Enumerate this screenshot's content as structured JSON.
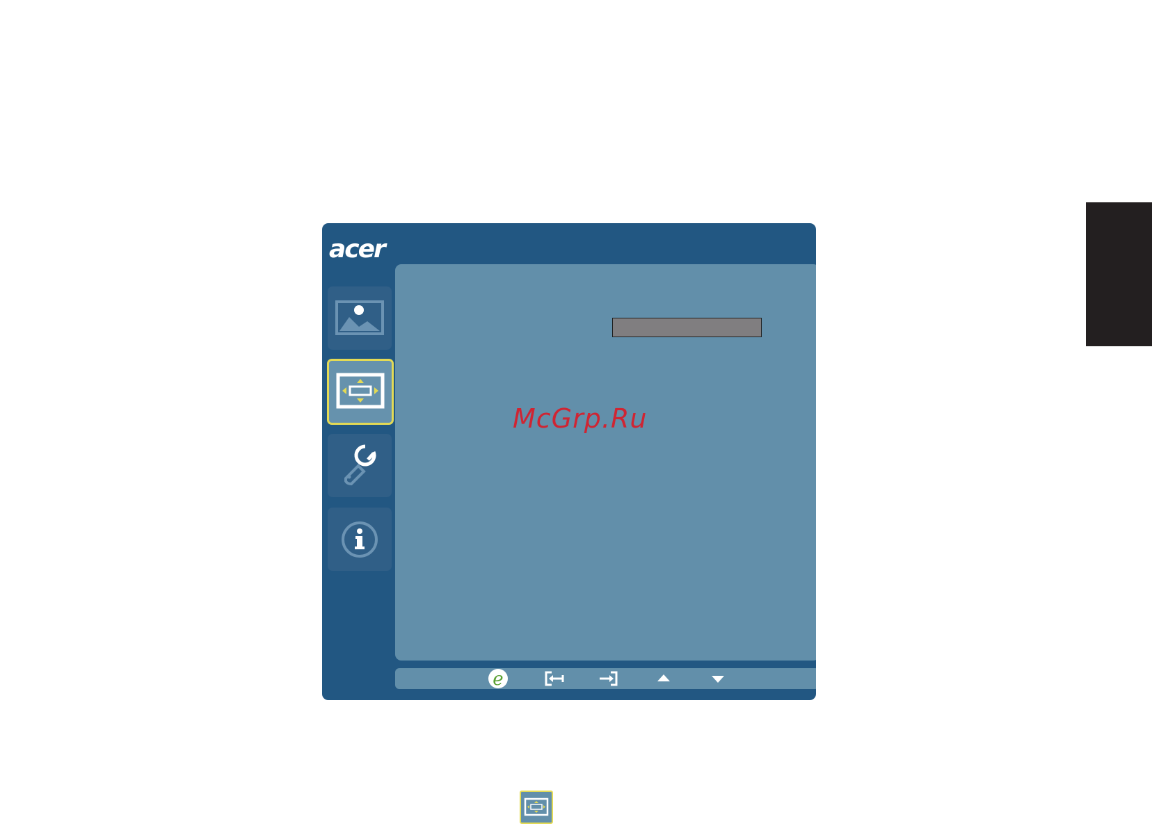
{
  "osd": {
    "brand": "acer",
    "tabs": [
      {
        "id": "picture",
        "icon": "picture-icon",
        "active": false
      },
      {
        "id": "display",
        "icon": "display-position-icon",
        "active": true
      },
      {
        "id": "settings",
        "icon": "wrench-settings-icon",
        "active": false
      },
      {
        "id": "information",
        "icon": "info-icon",
        "active": false
      }
    ],
    "footer_buttons": [
      {
        "id": "eco",
        "icon": "empowering-e-icon"
      },
      {
        "id": "back",
        "icon": "exit-icon"
      },
      {
        "id": "enter",
        "icon": "enter-icon"
      },
      {
        "id": "up",
        "icon": "up-arrow-icon"
      },
      {
        "id": "down",
        "icon": "down-arrow-icon"
      }
    ],
    "watermark": "McGrp.Ru",
    "colors": {
      "frame": "#225782",
      "panel": "#628faa",
      "tab": "#305f87",
      "highlight": "#e3da55",
      "bar": "#807e80",
      "eco_green": "#5aa032"
    }
  }
}
